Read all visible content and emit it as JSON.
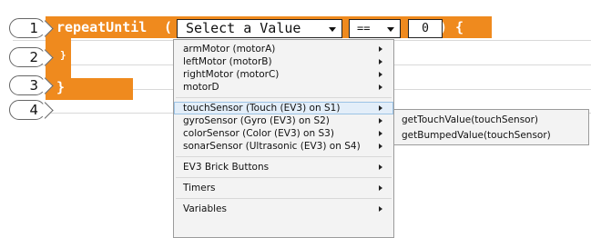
{
  "editor": {
    "lines": [
      "1",
      "2",
      "3",
      "4"
    ],
    "keyword": "repeatUntil",
    "open_paren": "(",
    "close_paren_brace": ") {",
    "line2_text": "}",
    "line3_text": "}"
  },
  "value_select": {
    "value": "Select a Value"
  },
  "operator_select": {
    "value": "=="
  },
  "number_field": {
    "value": "0"
  },
  "menu": {
    "groups": [
      [
        "armMotor (motorA)",
        "leftMotor (motorB)",
        "rightMotor (motorC)",
        "motorD"
      ],
      [
        "touchSensor (Touch (EV3) on S1)",
        "gyroSensor (Gyro (EV3) on S2)",
        "colorSensor (Color (EV3) on S3)",
        "sonarSensor (Ultrasonic (EV3) on S4)"
      ],
      [
        "EV3 Brick Buttons"
      ],
      [
        "Timers"
      ],
      [
        "Variables"
      ]
    ]
  },
  "submenu": {
    "items": [
      "getTouchValue(touchSensor)",
      "getBumpedValue(touchSensor)"
    ]
  },
  "colors": {
    "block": "#ef8a1e",
    "highlight": "#e3eef9"
  }
}
